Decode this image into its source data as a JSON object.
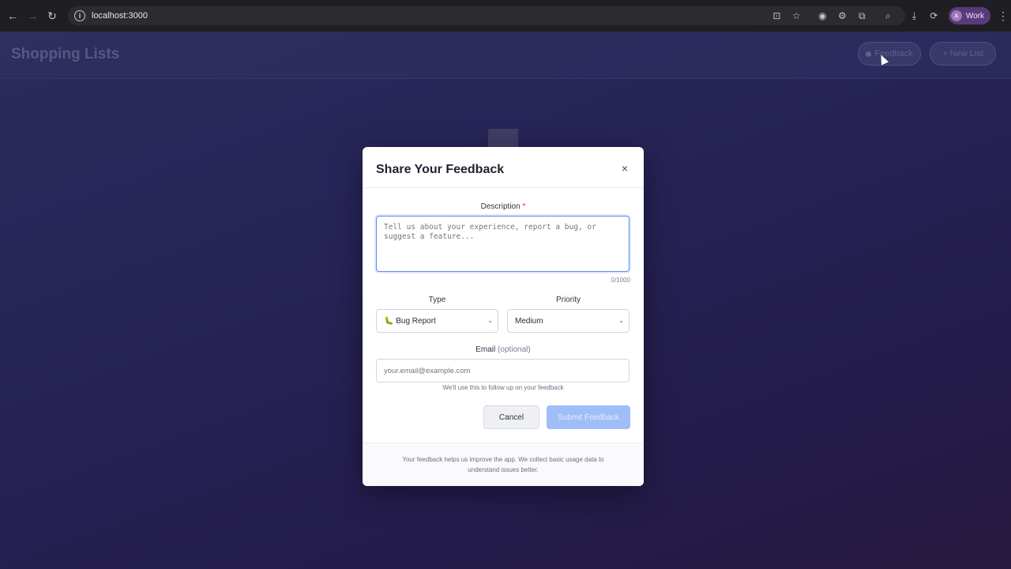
{
  "browser": {
    "url": "localhost:3000",
    "profile_initial": "A",
    "profile_label": "Work"
  },
  "app": {
    "title": "Shopping Lists",
    "feedback_button": "Feedback",
    "new_list_button": "+ New List"
  },
  "modal": {
    "title": "Share Your Feedback",
    "close_symbol": "×",
    "description_label": "Description",
    "description_required": "*",
    "description_placeholder": "Tell us about your experience, report a bug, or suggest a feature...",
    "char_counter": "0/1000",
    "type_label": "Type",
    "type_selected": "🐛 Bug Report",
    "priority_label": "Priority",
    "priority_selected": "Medium",
    "email_label": "Email",
    "email_optional": "(optional)",
    "email_placeholder": "your.email@example.com",
    "email_hint": "We'll use this to follow up on your feedback",
    "cancel_button": "Cancel",
    "submit_button": "Submit Feedback",
    "footer_text": "Your feedback helps us improve the app. We collect basic usage data to understand issues better."
  },
  "colors": {
    "accent": "#5b8def",
    "submit_disabled": "#9fbdf6",
    "required": "#e0245e"
  }
}
